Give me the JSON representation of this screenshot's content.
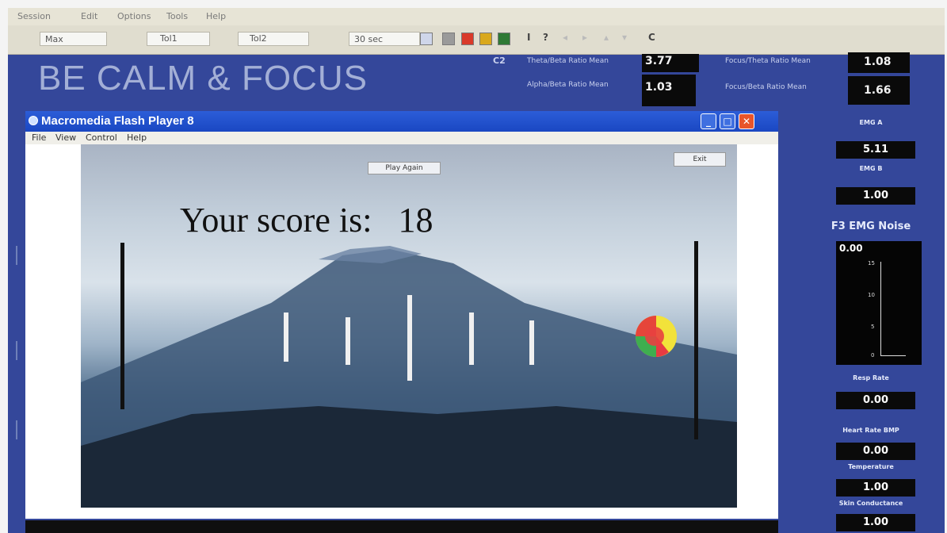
{
  "app": {
    "title": "BE CALM & FOCUS",
    "menu": [
      "Session",
      "Edit",
      "Options",
      "Tools",
      "Help"
    ]
  },
  "toolbar": {
    "field1": "Max",
    "label_tol1": "Tol1",
    "label_tol2": "Tol2",
    "dropdown": "30 sec",
    "glyphs": [
      "I",
      "?",
      "C"
    ]
  },
  "metrics": {
    "c2": "C2",
    "m1_label": "Theta/Beta Ratio Mean",
    "m1_value": "3.77",
    "m2_label": "Alpha/Beta Ratio Mean",
    "m2_value": "1.03",
    "m3_label": "Focus/Theta Ratio Mean",
    "m3_value": "1.08",
    "m4_label": "Focus/Beta Ratio Mean",
    "m4_value": "1.66"
  },
  "flash": {
    "title": "Macromedia Flash Player 8",
    "menu": [
      "File",
      "View",
      "Control",
      "Help"
    ],
    "play_again": "Play Again",
    "exit": "Exit",
    "score_label": "Your score is:",
    "score_value": "18"
  },
  "right_panel": {
    "emg_a_label": "EMG A",
    "emg_a_value": "5.11",
    "emg_b_label": "EMG B",
    "emg_b_value": "1.00",
    "noise_title": "F3 EMG Noise",
    "noise_value": "0.00",
    "noise_ticks": [
      "15",
      "10",
      "5",
      "0"
    ],
    "resp_label": "Resp Rate",
    "resp_value": "0.00",
    "hr_label": "Heart Rate BMP",
    "hr_value": "0.00",
    "temp_label": "Temperature",
    "temp_value": "1.00",
    "skin_label": "Skin Conductance",
    "skin_value": "1.00"
  },
  "colors": {
    "frame_bg": "#34479a",
    "title_text": "#a3afd6",
    "xp_blue": "#2c5dd8",
    "close_red": "#e8552a"
  }
}
